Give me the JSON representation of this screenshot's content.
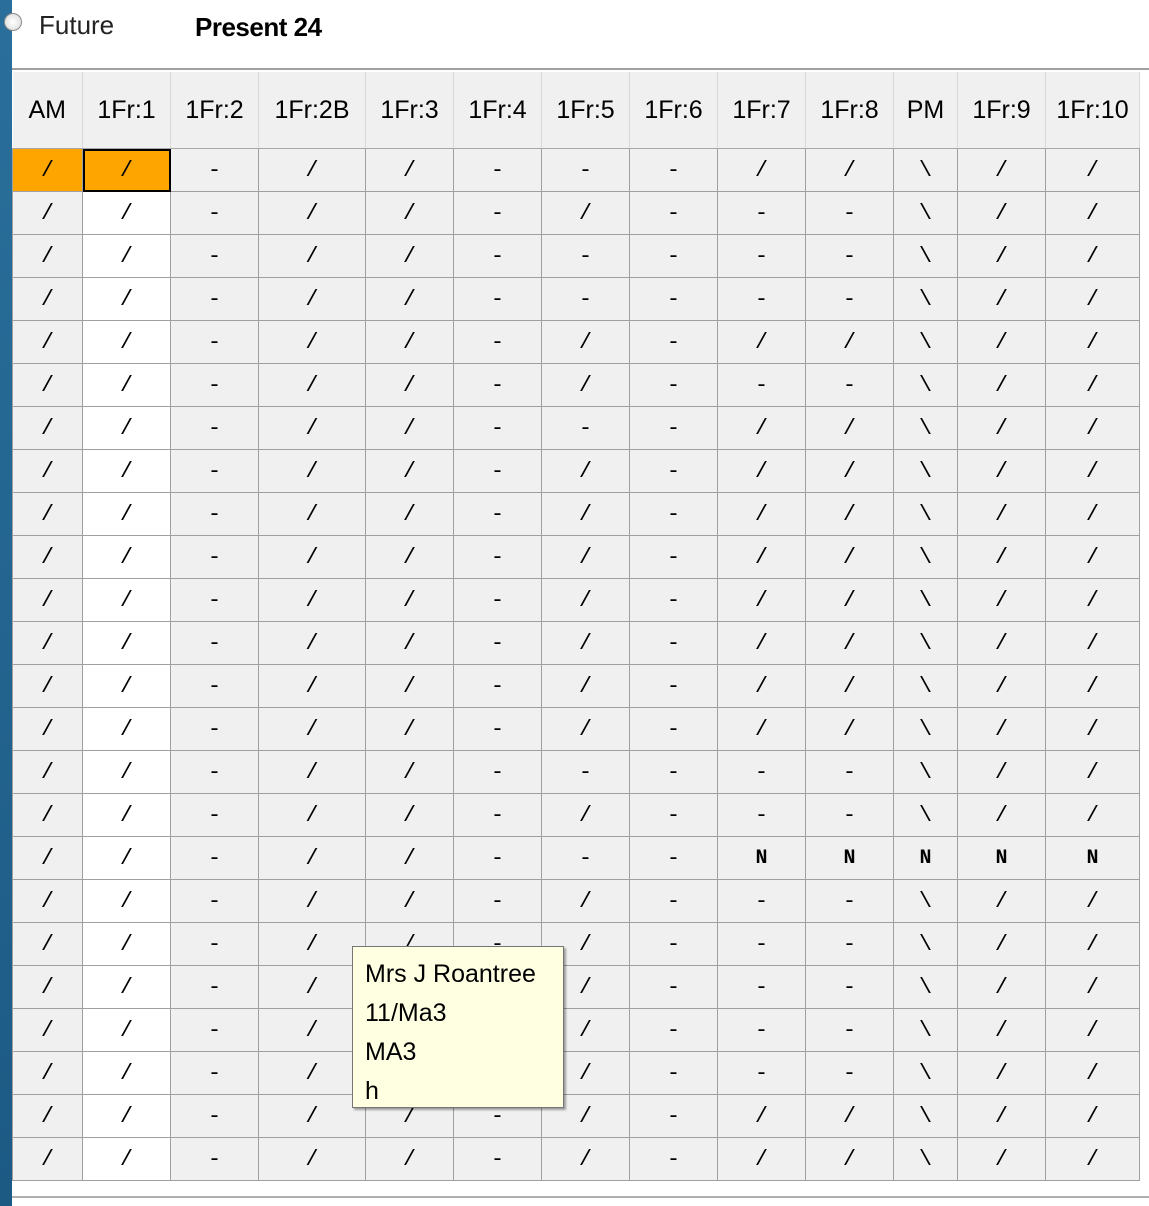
{
  "header": {
    "future_label": "Future",
    "present_label": "Present 24"
  },
  "columns": [
    "AM",
    "1Fr:1",
    "1Fr:2",
    "1Fr:2B",
    "1Fr:3",
    "1Fr:4",
    "1Fr:5",
    "1Fr:6",
    "1Fr:7",
    "1Fr:8",
    "PM",
    "1Fr:9",
    "1Fr:10"
  ],
  "rows": [
    [
      "/",
      "/",
      "-",
      "/",
      "/",
      "-",
      "-",
      "-",
      "/",
      "/",
      "\\",
      "/",
      "/"
    ],
    [
      "/",
      "/",
      "-",
      "/",
      "/",
      "-",
      "/",
      "-",
      "-",
      "-",
      "\\",
      "/",
      "/"
    ],
    [
      "/",
      "/",
      "-",
      "/",
      "/",
      "-",
      "-",
      "-",
      "-",
      "-",
      "\\",
      "/",
      "/"
    ],
    [
      "/",
      "/",
      "-",
      "/",
      "/",
      "-",
      "-",
      "-",
      "-",
      "-",
      "\\",
      "/",
      "/"
    ],
    [
      "/",
      "/",
      "-",
      "/",
      "/",
      "-",
      "/",
      "-",
      "/",
      "/",
      "\\",
      "/",
      "/"
    ],
    [
      "/",
      "/",
      "-",
      "/",
      "/",
      "-",
      "/",
      "-",
      "-",
      "-",
      "\\",
      "/",
      "/"
    ],
    [
      "/",
      "/",
      "-",
      "/",
      "/",
      "-",
      "-",
      "-",
      "/",
      "/",
      "\\",
      "/",
      "/"
    ],
    [
      "/",
      "/",
      "-",
      "/",
      "/",
      "-",
      "/",
      "-",
      "/",
      "/",
      "\\",
      "/",
      "/"
    ],
    [
      "/",
      "/",
      "-",
      "/",
      "/",
      "-",
      "/",
      "-",
      "/",
      "/",
      "\\",
      "/",
      "/"
    ],
    [
      "/",
      "/",
      "-",
      "/",
      "/",
      "-",
      "/",
      "-",
      "/",
      "/",
      "\\",
      "/",
      "/"
    ],
    [
      "/",
      "/",
      "-",
      "/",
      "/",
      "-",
      "/",
      "-",
      "/",
      "/",
      "\\",
      "/",
      "/"
    ],
    [
      "/",
      "/",
      "-",
      "/",
      "/",
      "-",
      "/",
      "-",
      "/",
      "/",
      "\\",
      "/",
      "/"
    ],
    [
      "/",
      "/",
      "-",
      "/",
      "/",
      "-",
      "/",
      "-",
      "/",
      "/",
      "\\",
      "/",
      "/"
    ],
    [
      "/",
      "/",
      "-",
      "/",
      "/",
      "-",
      "/",
      "-",
      "/",
      "/",
      "\\",
      "/",
      "/"
    ],
    [
      "/",
      "/",
      "-",
      "/",
      "/",
      "-",
      "-",
      "-",
      "-",
      "-",
      "\\",
      "/",
      "/"
    ],
    [
      "/",
      "/",
      "-",
      "/",
      "/",
      "-",
      "/",
      "-",
      "-",
      "-",
      "\\",
      "/",
      "/"
    ],
    [
      "/",
      "/",
      "-",
      "/",
      "/",
      "-",
      "-",
      "-",
      "N",
      "N",
      "N",
      "N",
      "N"
    ],
    [
      "/",
      "/",
      "-",
      "/",
      "/",
      "-",
      "/",
      "-",
      "-",
      "-",
      "\\",
      "/",
      "/"
    ],
    [
      "/",
      "/",
      "-",
      "/",
      "/",
      "-",
      "/",
      "-",
      "-",
      "-",
      "\\",
      "/",
      "/"
    ],
    [
      "/",
      "/",
      "-",
      "/",
      "/",
      "-",
      "/",
      "-",
      "-",
      "-",
      "\\",
      "/",
      "/"
    ],
    [
      "/",
      "/",
      "-",
      "/",
      "/",
      "-",
      "/",
      "-",
      "-",
      "-",
      "\\",
      "/",
      "/"
    ],
    [
      "/",
      "/",
      "-",
      "/",
      "/",
      "-",
      "/",
      "-",
      "-",
      "-",
      "\\",
      "/",
      "/"
    ],
    [
      "/",
      "/",
      "-",
      "/",
      "/",
      "-",
      "/",
      "-",
      "/",
      "/",
      "\\",
      "/",
      "/"
    ],
    [
      "/",
      "/",
      "-",
      "/",
      "/",
      "-",
      "/",
      "-",
      "/",
      "/",
      "\\",
      "/",
      "/"
    ]
  ],
  "tooltip": {
    "line1": "Mrs J Roantree",
    "line2": "11/Ma3",
    "line3": "MA3",
    "line4": "h"
  },
  "colors": {
    "selected": "#ffa500",
    "tooltip_bg": "#ffffe1"
  }
}
